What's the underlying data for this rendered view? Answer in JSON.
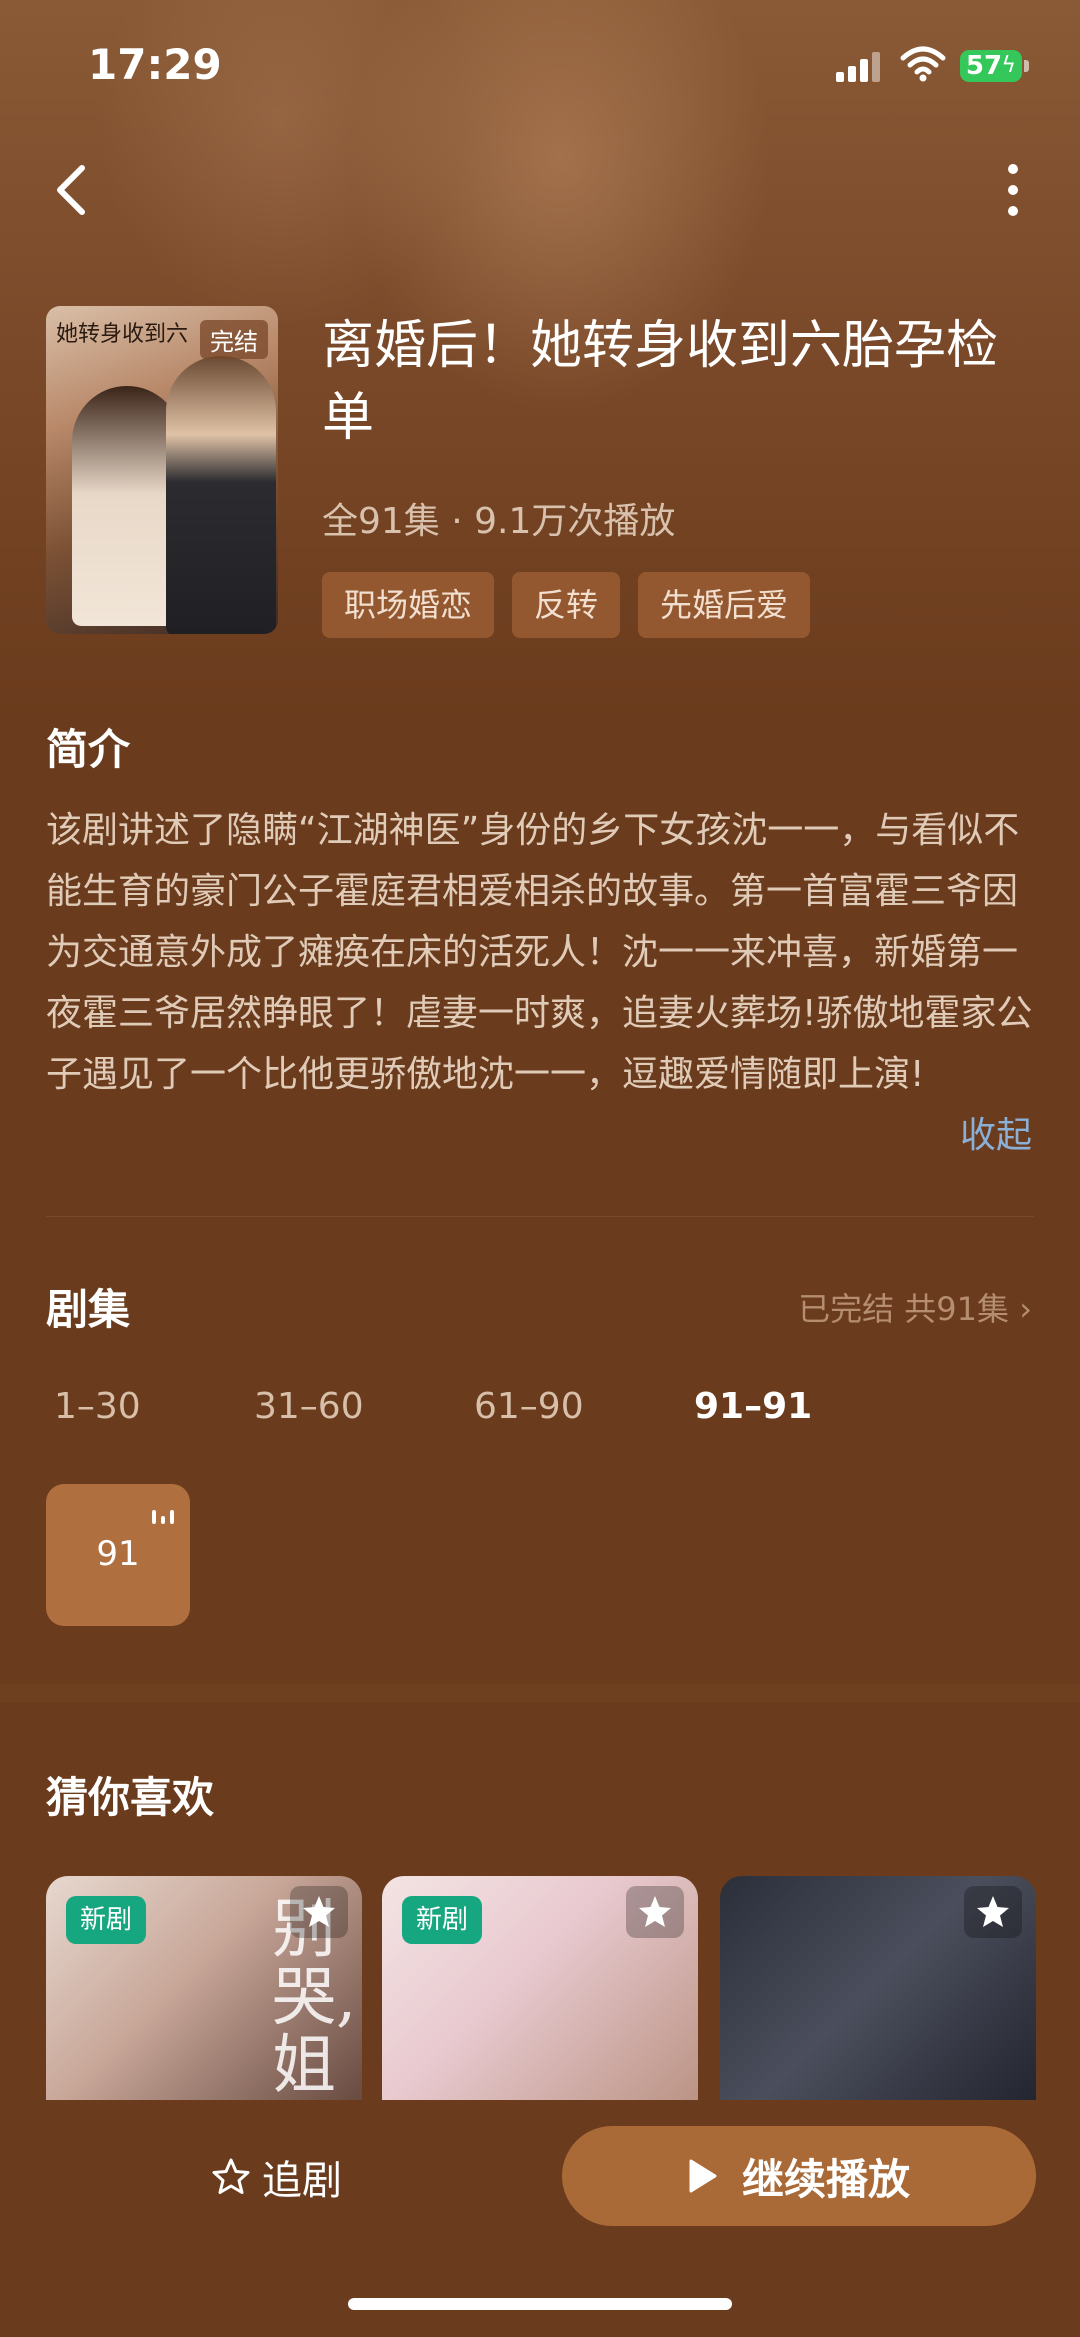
{
  "status_bar": {
    "time": "17:29",
    "battery": "57"
  },
  "show": {
    "cover_title": "她转身收到六",
    "cover_badge": "完结",
    "title": "离婚后！她转身收到六胎孕检单",
    "meta": "全91集 · 9.1万次播放",
    "tags": [
      "职场婚恋",
      "反转",
      "先婚后爱"
    ]
  },
  "synopsis": {
    "heading": "简介",
    "text": "该剧讲述了隐瞒“江湖神医”身份的乡下女孩沈一一，与看似不能生育的豪门公子霍庭君相爱相杀的故事。第一首富霍三爷因为交通意外成了瘫痪在床的活死人！沈一一来冲喜，新婚第一夜霍三爷居然睁眼了！虐妻一时爽，追妻火葬场!骄傲地霍家公子遇见了一个比他更骄傲地沈一一，逗趣爱情随即上演!",
    "collapse_label": "收起"
  },
  "episodes": {
    "heading": "剧集",
    "summary": "已完结 共91集 ›",
    "ranges": [
      "1–30",
      "31–60",
      "61–90",
      "91–91"
    ],
    "active_range": "91–91",
    "tiles": [
      "91"
    ]
  },
  "recommend": {
    "heading": "猜你喜欢",
    "cards": [
      {
        "badge": "新剧",
        "art_text": "别哭,姐姐来了"
      },
      {
        "badge": "新剧",
        "art_text": ""
      },
      {
        "badge": "",
        "art_text": ""
      }
    ]
  },
  "bottom": {
    "follow_label": "追剧",
    "play_label": "继续播放"
  },
  "colors": {
    "background": "#6a3b1c",
    "accent": "#a96a38",
    "tag_bg": "#93582f",
    "new_badge": "#16a680",
    "link": "#8ab0d8"
  }
}
